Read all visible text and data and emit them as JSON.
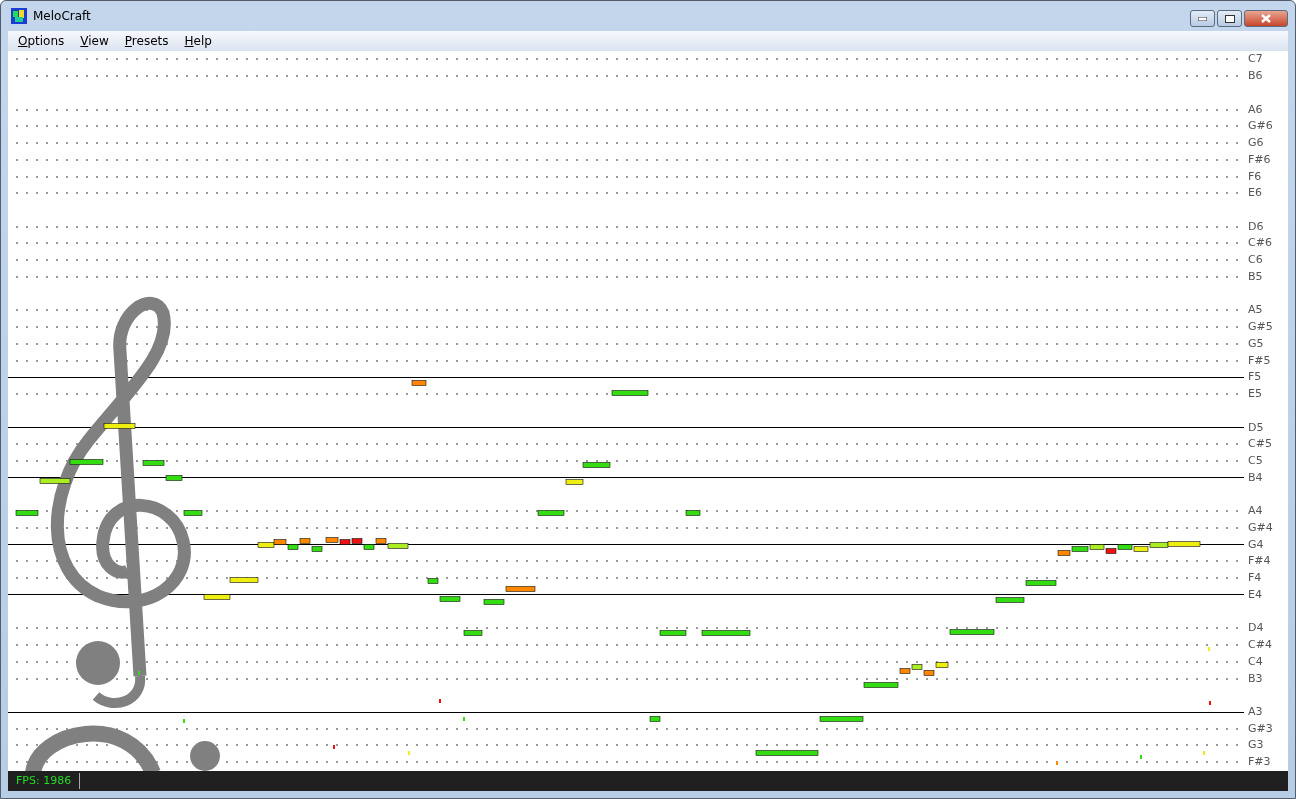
{
  "window": {
    "title": "MeloCraft"
  },
  "menu": [
    "Options",
    "View",
    "Presets",
    "Help"
  ],
  "pitch_rows": [
    {
      "label": "C7",
      "staff_line": false
    },
    {
      "label": "B6",
      "staff_line": false
    },
    {
      "staff_line": false
    },
    {
      "label": "A6",
      "staff_line": false
    },
    {
      "label": "G#6",
      "staff_line": false
    },
    {
      "label": "G6",
      "staff_line": false
    },
    {
      "label": "F#6",
      "staff_line": false
    },
    {
      "label": "F6",
      "staff_line": false
    },
    {
      "label": "E6",
      "staff_line": false
    },
    {
      "staff_line": false
    },
    {
      "label": "D6",
      "staff_line": false
    },
    {
      "label": "C#6",
      "staff_line": false
    },
    {
      "label": "C6",
      "staff_line": false
    },
    {
      "label": "B5",
      "staff_line": false
    },
    {
      "staff_line": false
    },
    {
      "label": "A5",
      "staff_line": false
    },
    {
      "label": "G#5",
      "staff_line": false
    },
    {
      "label": "G5",
      "staff_line": false
    },
    {
      "label": "F#5",
      "staff_line": false
    },
    {
      "label": "F5",
      "staff_line": true
    },
    {
      "label": "E5",
      "staff_line": false
    },
    {
      "staff_line": false
    },
    {
      "label": "D5",
      "staff_line": true
    },
    {
      "label": "C#5",
      "staff_line": false
    },
    {
      "label": "C5",
      "staff_line": false
    },
    {
      "label": "B4",
      "staff_line": true
    },
    {
      "staff_line": false
    },
    {
      "label": "A4",
      "staff_line": false
    },
    {
      "label": "G#4",
      "staff_line": false
    },
    {
      "label": "G4",
      "staff_line": true
    },
    {
      "label": "F#4",
      "staff_line": false
    },
    {
      "label": "F4",
      "staff_line": false
    },
    {
      "label": "E4",
      "staff_line": true
    },
    {
      "staff_line": false
    },
    {
      "label": "D4",
      "staff_line": false
    },
    {
      "label": "C#4",
      "staff_line": false
    },
    {
      "label": "C4",
      "staff_line": false
    },
    {
      "label": "B3",
      "staff_line": false
    },
    {
      "staff_line": false
    },
    {
      "label": "A3",
      "staff_line": true
    },
    {
      "label": "G#3",
      "staff_line": false
    },
    {
      "label": "G3",
      "staff_line": false
    },
    {
      "label": "F#3",
      "staff_line": false
    }
  ],
  "status_bar": {
    "fps": "FPS: 1986"
  }
}
